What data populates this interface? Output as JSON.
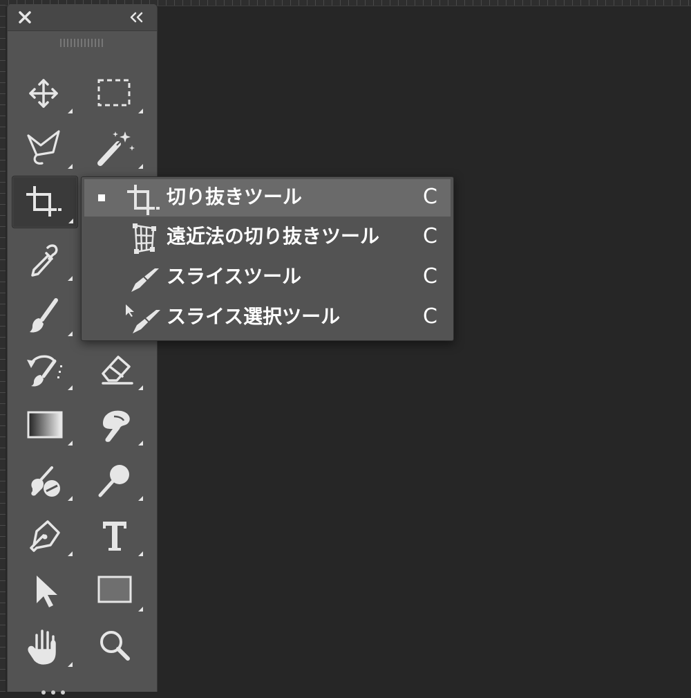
{
  "toolbar": {
    "close_icon": "close-icon",
    "collapse_icon": "double-chevron-left-icon",
    "tools": [
      {
        "name": "move-tool",
        "icon": "move-icon"
      },
      {
        "name": "rectangular-marquee-tool",
        "icon": "marquee-icon"
      },
      {
        "name": "lasso-tool",
        "icon": "lasso-icon"
      },
      {
        "name": "magic-wand-tool",
        "icon": "magic-wand-icon"
      },
      {
        "name": "crop-tool",
        "icon": "crop-icon",
        "selected": true
      },
      {
        "name": "eyedropper-tool",
        "icon": "eyedropper-icon"
      },
      {
        "name": "brush-tool",
        "icon": "brush-icon"
      },
      {
        "name": "history-brush-tool",
        "icon": "history-brush-icon"
      },
      {
        "name": "eraser-tool",
        "icon": "eraser-icon"
      },
      {
        "name": "gradient-tool",
        "icon": "gradient-icon"
      },
      {
        "name": "smudge-tool",
        "icon": "smudge-icon"
      },
      {
        "name": "burn-tool",
        "icon": "burn-icon"
      },
      {
        "name": "dodge-tool",
        "icon": "dodge-icon"
      },
      {
        "name": "pen-tool",
        "icon": "pen-icon"
      },
      {
        "name": "type-tool",
        "icon": "type-icon",
        "glyph": "T"
      },
      {
        "name": "path-selection-tool",
        "icon": "arrow-icon"
      },
      {
        "name": "rectangle-tool",
        "icon": "rectangle-icon"
      },
      {
        "name": "hand-tool",
        "icon": "hand-icon"
      },
      {
        "name": "zoom-tool",
        "icon": "zoom-icon"
      }
    ]
  },
  "flyout": {
    "items": [
      {
        "label": "切り抜きツール",
        "shortcut": "C",
        "icon": "crop-icon",
        "active": true
      },
      {
        "label": "遠近法の切り抜きツール",
        "shortcut": "C",
        "icon": "perspective-crop-icon"
      },
      {
        "label": "スライスツール",
        "shortcut": "C",
        "icon": "slice-icon"
      },
      {
        "label": "スライス選択ツール",
        "shortcut": "C",
        "icon": "slice-select-icon"
      }
    ]
  },
  "colors": {
    "canvas": "#262626",
    "panel": "#535353",
    "menu_highlight": "#6a6a6a",
    "icon": "#e6e6e6"
  }
}
